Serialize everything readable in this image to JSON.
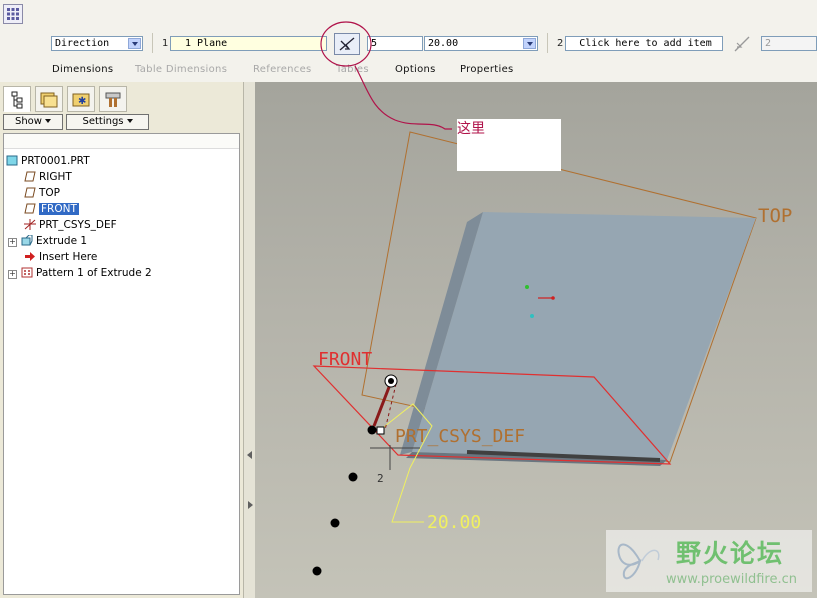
{
  "dashboard": {
    "direction_combo": "Direction",
    "ref1_index": "1",
    "ref1_value": "1 Plane",
    "count_value": "5",
    "distance_combo": "20.00",
    "ref2_index": "2",
    "ref2_value": "Click here to add item",
    "ref2_count": "2",
    "tabs": [
      "Dimensions",
      "Table Dimensions",
      "References",
      "Tables",
      "Options",
      "Properties"
    ]
  },
  "navigator": {
    "show_label": "Show",
    "settings_label": "Settings",
    "tree": [
      {
        "label": "PRT0001.PRT",
        "icon": "part-icon"
      },
      {
        "label": "RIGHT",
        "icon": "datum-plane-icon"
      },
      {
        "label": "TOP",
        "icon": "datum-plane-icon"
      },
      {
        "label": "FRONT",
        "icon": "datum-plane-icon",
        "selected": true
      },
      {
        "label": "PRT_CSYS_DEF",
        "icon": "csys-icon"
      },
      {
        "label": "Extrude 1",
        "icon": "extrude-icon"
      },
      {
        "label": "Insert Here",
        "icon": "insert-arrow-icon"
      },
      {
        "label": "Pattern 1 of Extrude 2",
        "icon": "pattern-icon"
      }
    ]
  },
  "graphics": {
    "label_top": "TOP",
    "label_front": "FRONT",
    "label_csys": "PRT_CSYS_DEF",
    "dim_value": "20.00",
    "pattern_index": "2"
  },
  "annotation": {
    "callout_text": "这里",
    "color": "#b0134a"
  },
  "watermark": {
    "title": "野火论坛",
    "url": "www.proewildfire.cn"
  },
  "colors": {
    "highlight": "#316ac5",
    "datum_plane": "#b07030",
    "selection_red": "#e03030",
    "dim_yellow": "#f0f060"
  }
}
